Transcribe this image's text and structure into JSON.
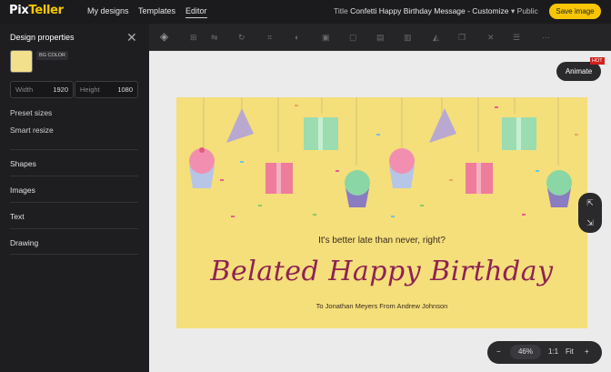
{
  "topbar": {
    "logo": {
      "part1": "Pix",
      "part2": "Teller"
    },
    "nav": [
      "My designs",
      "Templates",
      "Editor"
    ],
    "title_label": "Title",
    "title_value": "Confetti Happy Birthday Message - Customize",
    "visibility": "Public",
    "save_label": "Save image"
  },
  "sidebar": {
    "title": "Design properties",
    "bg_tag": "BG COLOR",
    "bg_color": "#f2e08c",
    "width_label": "Width",
    "width_value": "1920",
    "height_label": "Height",
    "height_value": "1080",
    "links": [
      "Preset sizes",
      "Smart resize"
    ],
    "sections": [
      "Shapes",
      "Images",
      "Text",
      "Drawing"
    ]
  },
  "canvas": {
    "line1": "It's better late than never, right?",
    "line2": "Belated Happy Birthday",
    "line3": "To Jonathan Meyers From Andrew Johnson"
  },
  "animate": {
    "label": "Animate",
    "badge": "HOT"
  },
  "zoom": {
    "minus": "−",
    "value": "46%",
    "one_to_one": "1:1",
    "fit": "Fit",
    "plus": "+"
  }
}
